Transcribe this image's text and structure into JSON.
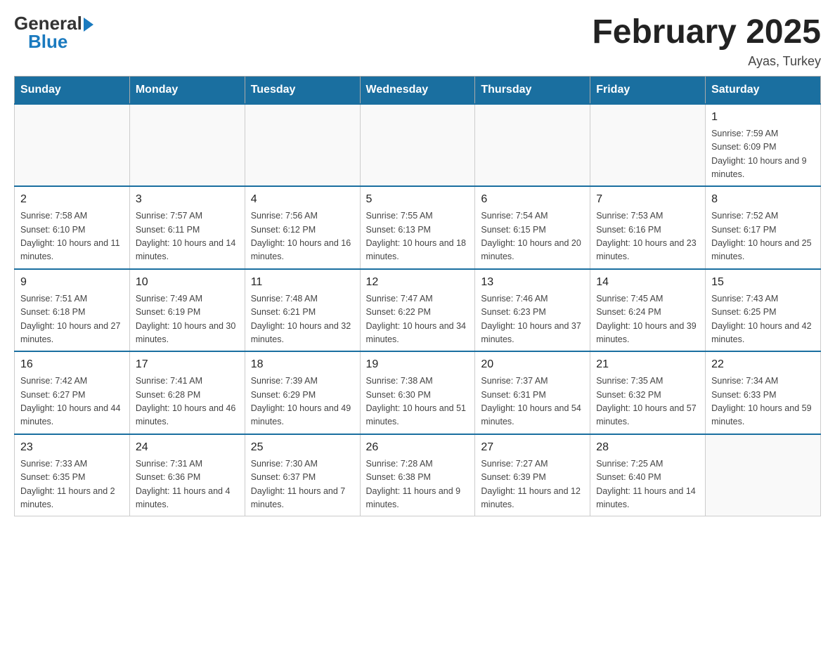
{
  "header": {
    "logo_general": "General",
    "logo_blue": "Blue",
    "month_title": "February 2025",
    "location": "Ayas, Turkey"
  },
  "weekdays": [
    "Sunday",
    "Monday",
    "Tuesday",
    "Wednesday",
    "Thursday",
    "Friday",
    "Saturday"
  ],
  "weeks": [
    [
      {
        "day": "",
        "info": ""
      },
      {
        "day": "",
        "info": ""
      },
      {
        "day": "",
        "info": ""
      },
      {
        "day": "",
        "info": ""
      },
      {
        "day": "",
        "info": ""
      },
      {
        "day": "",
        "info": ""
      },
      {
        "day": "1",
        "info": "Sunrise: 7:59 AM\nSunset: 6:09 PM\nDaylight: 10 hours and 9 minutes."
      }
    ],
    [
      {
        "day": "2",
        "info": "Sunrise: 7:58 AM\nSunset: 6:10 PM\nDaylight: 10 hours and 11 minutes."
      },
      {
        "day": "3",
        "info": "Sunrise: 7:57 AM\nSunset: 6:11 PM\nDaylight: 10 hours and 14 minutes."
      },
      {
        "day": "4",
        "info": "Sunrise: 7:56 AM\nSunset: 6:12 PM\nDaylight: 10 hours and 16 minutes."
      },
      {
        "day": "5",
        "info": "Sunrise: 7:55 AM\nSunset: 6:13 PM\nDaylight: 10 hours and 18 minutes."
      },
      {
        "day": "6",
        "info": "Sunrise: 7:54 AM\nSunset: 6:15 PM\nDaylight: 10 hours and 20 minutes."
      },
      {
        "day": "7",
        "info": "Sunrise: 7:53 AM\nSunset: 6:16 PM\nDaylight: 10 hours and 23 minutes."
      },
      {
        "day": "8",
        "info": "Sunrise: 7:52 AM\nSunset: 6:17 PM\nDaylight: 10 hours and 25 minutes."
      }
    ],
    [
      {
        "day": "9",
        "info": "Sunrise: 7:51 AM\nSunset: 6:18 PM\nDaylight: 10 hours and 27 minutes."
      },
      {
        "day": "10",
        "info": "Sunrise: 7:49 AM\nSunset: 6:19 PM\nDaylight: 10 hours and 30 minutes."
      },
      {
        "day": "11",
        "info": "Sunrise: 7:48 AM\nSunset: 6:21 PM\nDaylight: 10 hours and 32 minutes."
      },
      {
        "day": "12",
        "info": "Sunrise: 7:47 AM\nSunset: 6:22 PM\nDaylight: 10 hours and 34 minutes."
      },
      {
        "day": "13",
        "info": "Sunrise: 7:46 AM\nSunset: 6:23 PM\nDaylight: 10 hours and 37 minutes."
      },
      {
        "day": "14",
        "info": "Sunrise: 7:45 AM\nSunset: 6:24 PM\nDaylight: 10 hours and 39 minutes."
      },
      {
        "day": "15",
        "info": "Sunrise: 7:43 AM\nSunset: 6:25 PM\nDaylight: 10 hours and 42 minutes."
      }
    ],
    [
      {
        "day": "16",
        "info": "Sunrise: 7:42 AM\nSunset: 6:27 PM\nDaylight: 10 hours and 44 minutes."
      },
      {
        "day": "17",
        "info": "Sunrise: 7:41 AM\nSunset: 6:28 PM\nDaylight: 10 hours and 46 minutes."
      },
      {
        "day": "18",
        "info": "Sunrise: 7:39 AM\nSunset: 6:29 PM\nDaylight: 10 hours and 49 minutes."
      },
      {
        "day": "19",
        "info": "Sunrise: 7:38 AM\nSunset: 6:30 PM\nDaylight: 10 hours and 51 minutes."
      },
      {
        "day": "20",
        "info": "Sunrise: 7:37 AM\nSunset: 6:31 PM\nDaylight: 10 hours and 54 minutes."
      },
      {
        "day": "21",
        "info": "Sunrise: 7:35 AM\nSunset: 6:32 PM\nDaylight: 10 hours and 57 minutes."
      },
      {
        "day": "22",
        "info": "Sunrise: 7:34 AM\nSunset: 6:33 PM\nDaylight: 10 hours and 59 minutes."
      }
    ],
    [
      {
        "day": "23",
        "info": "Sunrise: 7:33 AM\nSunset: 6:35 PM\nDaylight: 11 hours and 2 minutes."
      },
      {
        "day": "24",
        "info": "Sunrise: 7:31 AM\nSunset: 6:36 PM\nDaylight: 11 hours and 4 minutes."
      },
      {
        "day": "25",
        "info": "Sunrise: 7:30 AM\nSunset: 6:37 PM\nDaylight: 11 hours and 7 minutes."
      },
      {
        "day": "26",
        "info": "Sunrise: 7:28 AM\nSunset: 6:38 PM\nDaylight: 11 hours and 9 minutes."
      },
      {
        "day": "27",
        "info": "Sunrise: 7:27 AM\nSunset: 6:39 PM\nDaylight: 11 hours and 12 minutes."
      },
      {
        "day": "28",
        "info": "Sunrise: 7:25 AM\nSunset: 6:40 PM\nDaylight: 11 hours and 14 minutes."
      },
      {
        "day": "",
        "info": ""
      }
    ]
  ]
}
